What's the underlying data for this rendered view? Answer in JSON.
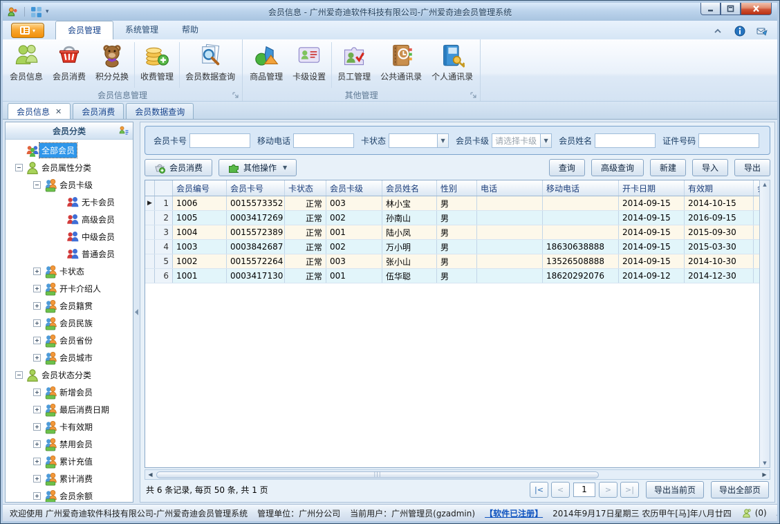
{
  "window": {
    "title": "会员信息 - 广州爱奇迪软件科技有限公司-广州爱奇迪会员管理系统"
  },
  "ribbon": {
    "tabs": [
      {
        "label": "会员管理",
        "active": true
      },
      {
        "label": "系统管理",
        "active": false
      },
      {
        "label": "帮助",
        "active": false
      }
    ],
    "groups": [
      {
        "label": "会员信息管理",
        "buttons": [
          {
            "label": "会员信息",
            "icon": "members-icon"
          },
          {
            "label": "会员消费",
            "icon": "basket-icon"
          },
          {
            "label": "积分兑换",
            "icon": "teddy-bear-icon",
            "sep_after": true
          },
          {
            "label": "收费管理",
            "icon": "coins-icon",
            "sep_after": true
          },
          {
            "label": "会员数据查询",
            "icon": "doc-search-icon"
          }
        ]
      },
      {
        "label": "其他管理",
        "buttons": [
          {
            "label": "商品管理",
            "icon": "goods-icon"
          },
          {
            "label": "卡级设置",
            "icon": "card-settings-icon",
            "sep_after": true
          },
          {
            "label": "员工管理",
            "icon": "staff-icon"
          },
          {
            "label": "公共通讯录",
            "icon": "public-contacts-icon"
          },
          {
            "label": "个人通讯录",
            "icon": "personal-contacts-icon"
          }
        ]
      }
    ]
  },
  "doc_tabs": [
    {
      "label": "会员信息",
      "active": true,
      "closable": true
    },
    {
      "label": "会员消费",
      "active": false
    },
    {
      "label": "会员数据查询",
      "active": false
    }
  ],
  "sidebar": {
    "title": "会员分类",
    "tree": [
      {
        "label": "全部会员",
        "level": 1,
        "icon": "group",
        "expand": "",
        "selected": true
      },
      {
        "label": "会员属性分类",
        "level": 1,
        "icon": "person",
        "expand": "-"
      },
      {
        "label": "会员卡级",
        "level": 2,
        "icon": "duo",
        "expand": "-"
      },
      {
        "label": "无卡会员",
        "level": 3,
        "icon": "leaf",
        "expand": ""
      },
      {
        "label": "高级会员",
        "level": 3,
        "icon": "leaf",
        "expand": ""
      },
      {
        "label": "中级会员",
        "level": 3,
        "icon": "leaf",
        "expand": ""
      },
      {
        "label": "普通会员",
        "level": 3,
        "icon": "leaf",
        "expand": ""
      },
      {
        "label": "卡状态",
        "level": 2,
        "icon": "duo",
        "expand": "+"
      },
      {
        "label": "开卡介绍人",
        "level": 2,
        "icon": "duo",
        "expand": "+"
      },
      {
        "label": "会员籍贯",
        "level": 2,
        "icon": "duo",
        "expand": "+"
      },
      {
        "label": "会员民族",
        "level": 2,
        "icon": "duo",
        "expand": "+"
      },
      {
        "label": "会员省份",
        "level": 2,
        "icon": "duo",
        "expand": "+"
      },
      {
        "label": "会员城市",
        "level": 2,
        "icon": "duo",
        "expand": "+"
      },
      {
        "label": "会员状态分类",
        "level": 1,
        "icon": "person",
        "expand": "-"
      },
      {
        "label": "新增会员",
        "level": 2,
        "icon": "duo",
        "expand": "+"
      },
      {
        "label": "最后消费日期",
        "level": 2,
        "icon": "duo",
        "expand": "+"
      },
      {
        "label": "卡有效期",
        "level": 2,
        "icon": "duo",
        "expand": "+"
      },
      {
        "label": "禁用会员",
        "level": 2,
        "icon": "duo",
        "expand": "+"
      },
      {
        "label": "累计充值",
        "level": 2,
        "icon": "duo",
        "expand": "+"
      },
      {
        "label": "累计消费",
        "level": 2,
        "icon": "duo",
        "expand": "+"
      },
      {
        "label": "会员余额",
        "level": 2,
        "icon": "duo",
        "expand": "+"
      }
    ]
  },
  "filters": {
    "fields": [
      {
        "label": "会员卡号",
        "type": "input",
        "value": ""
      },
      {
        "label": "移动电话",
        "type": "input",
        "value": ""
      },
      {
        "label": "卡状态",
        "type": "select",
        "value": "",
        "placeholder": ""
      },
      {
        "label": "会员卡级",
        "type": "select",
        "value": "",
        "placeholder": "请选择卡级"
      },
      {
        "label": "会员姓名",
        "type": "input",
        "value": ""
      },
      {
        "label": "证件号码",
        "type": "input",
        "value": ""
      }
    ]
  },
  "actions": {
    "left": [
      {
        "label": "会员消费",
        "icon": "basket-add-icon",
        "key": "member-consume-button"
      },
      {
        "label": "其他操作",
        "icon": "puzzle-icon",
        "dropdown": true,
        "key": "more-actions-button"
      }
    ],
    "right": [
      {
        "label": "查询",
        "key": "query-button"
      },
      {
        "label": "高级查询",
        "key": "advanced-query-button"
      },
      {
        "label": "新建",
        "key": "new-button"
      },
      {
        "label": "导入",
        "key": "import-button"
      },
      {
        "label": "导出",
        "key": "export-button"
      }
    ]
  },
  "grid": {
    "columns": [
      {
        "label": "会员编号",
        "width": 78
      },
      {
        "label": "会员卡号",
        "width": 84
      },
      {
        "label": "卡状态",
        "width": 60,
        "align": "right"
      },
      {
        "label": "会员卡级",
        "width": 81
      },
      {
        "label": "会员姓名",
        "width": 79
      },
      {
        "label": "性别",
        "width": 58
      },
      {
        "label": "电话",
        "width": 95
      },
      {
        "label": "移动电话",
        "width": 110
      },
      {
        "label": "开卡日期",
        "width": 95
      },
      {
        "label": "有效期",
        "width": 100
      },
      {
        "label": "会员",
        "width": 40
      }
    ],
    "rows": [
      {
        "num": "1",
        "current": true,
        "cells": [
          "1006",
          "0015573352",
          "正常",
          "003",
          "林小宝",
          "男",
          "",
          "",
          "2014-09-15",
          "2014-10-15",
          ""
        ]
      },
      {
        "num": "2",
        "cells": [
          "1005",
          "0003417269",
          "正常",
          "002",
          "孙南山",
          "男",
          "",
          "",
          "2014-09-15",
          "2016-09-15",
          ""
        ]
      },
      {
        "num": "3",
        "cells": [
          "1004",
          "0015572389",
          "正常",
          "001",
          "陆小凤",
          "男",
          "",
          "",
          "2014-09-15",
          "2015-09-30",
          ""
        ]
      },
      {
        "num": "4",
        "cells": [
          "1003",
          "0003842687",
          "正常",
          "002",
          "万小明",
          "男",
          "",
          "18630638888",
          "2014-09-15",
          "2015-03-30",
          ""
        ]
      },
      {
        "num": "5",
        "cells": [
          "1002",
          "0015572264",
          "正常",
          "003",
          "张小山",
          "男",
          "",
          "13526508888",
          "2014-09-15",
          "2014-10-30",
          ""
        ]
      },
      {
        "num": "6",
        "cells": [
          "1001",
          "0003417130",
          "正常",
          "001",
          "伍华聪",
          "男",
          "",
          "18620292076",
          "2014-09-12",
          "2014-12-30",
          ""
        ]
      }
    ]
  },
  "pager": {
    "summary": "共 6 条记录, 每页 50 条, 共 1 页",
    "first": "|<",
    "prev": "<",
    "page": "1",
    "next": ">",
    "last": ">|",
    "export_current": "导出当前页",
    "export_all": "导出全部页"
  },
  "status": {
    "welcome": "欢迎使用 广州爱奇迪软件科技有限公司-广州爱奇迪会员管理系统",
    "unit": "管理单位：广州分公司",
    "user": "当前用户：广州管理员(gzadmin)",
    "registered": "【软件已注册】",
    "date": "2014年9月17日星期三 农历甲午[马]年八月廿四",
    "msg_count": "(0)"
  }
}
